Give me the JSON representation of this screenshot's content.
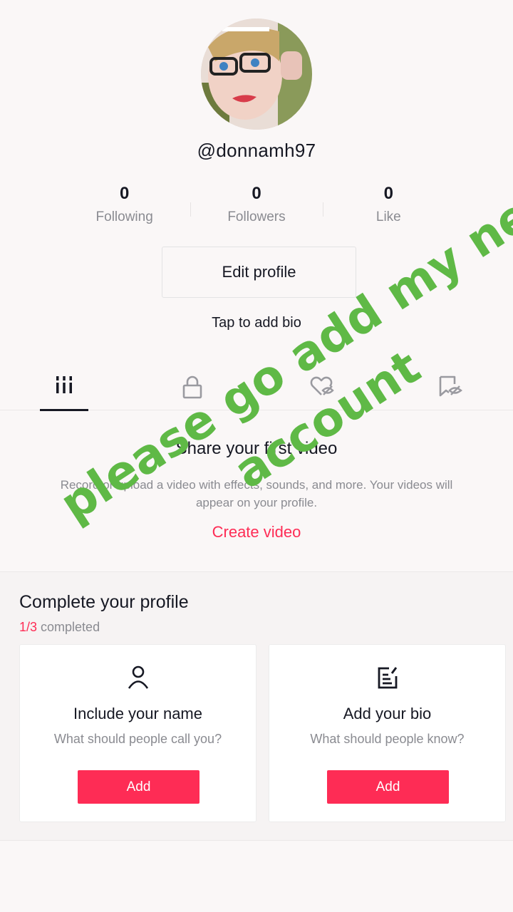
{
  "profile": {
    "username": "@donnamh97"
  },
  "stats": [
    {
      "value": "0",
      "label": "Following"
    },
    {
      "value": "0",
      "label": "Followers"
    },
    {
      "value": "0",
      "label": "Like"
    }
  ],
  "edit_profile_label": "Edit profile",
  "bio_hint": "Tap to add bio",
  "tabs": [
    {
      "icon": "grid-icon",
      "active": true
    },
    {
      "icon": "lock-icon",
      "active": false
    },
    {
      "icon": "heart-hidden-icon",
      "active": false
    },
    {
      "icon": "bookmark-hidden-icon",
      "active": false
    }
  ],
  "empty_state": {
    "title": "Share your first video",
    "description": "Record or upload a video with effects, sounds, and more. Your videos will appear on your profile.",
    "create_link": "Create video"
  },
  "complete_profile": {
    "title": "Complete your profile",
    "progress_num": "1/3",
    "progress_text": " completed",
    "cards": [
      {
        "icon": "person-icon",
        "title": "Include your name",
        "subtitle": "What should people call you?",
        "button": "Add"
      },
      {
        "icon": "edit-bio-icon",
        "title": "Add your bio",
        "subtitle": "What should people know?",
        "button": "Add"
      }
    ]
  },
  "overlay_text": {
    "line1": "please go add my new",
    "line2": "account"
  },
  "colors": {
    "accent": "#fe2c55",
    "overlay": "#5fb946",
    "text": "#161823",
    "muted": "#8a8b91"
  }
}
